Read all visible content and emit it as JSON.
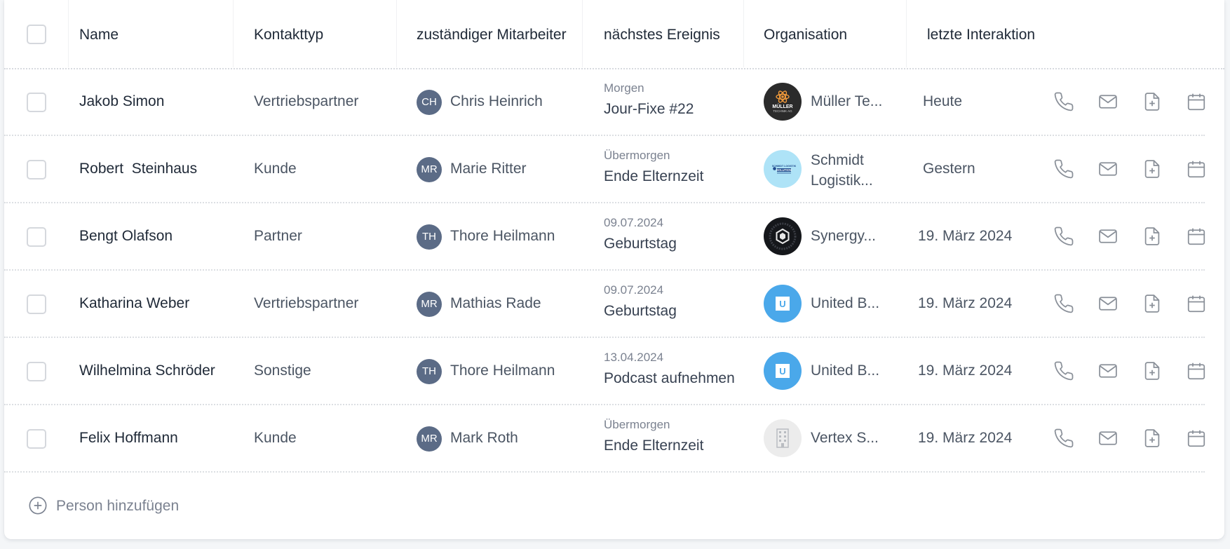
{
  "header": {
    "name": "Name",
    "contact_type": "Kontakttyp",
    "employee": "zuständiger Mitarbeiter",
    "next_event": "nächstes Ereignis",
    "organisation": "Organisation",
    "last_interaction": "letzte Interaktion"
  },
  "rows": [
    {
      "name": "Jakob Simon",
      "type": "Vertriebspartner",
      "initials": "CH",
      "employee": "Chris Heinrich",
      "event_date": "Morgen",
      "event_title": "Jour-Fixe #22",
      "org_line1": "Müller Te...",
      "org_line2": "",
      "org_logo": "mueller-logo",
      "last": "Heute"
    },
    {
      "name": "Robert  Steinhaus",
      "type": "Kunde",
      "initials": "MR",
      "employee": "Marie Ritter",
      "event_date": "Übermorgen",
      "event_title": "Ende Elternzeit",
      "org_line1": "Schmidt",
      "org_line2": "Logistik...",
      "org_logo": "schmidt-logo",
      "last": "Gestern"
    },
    {
      "name": "Bengt Olafson",
      "type": "Partner",
      "initials": "TH",
      "employee": "Thore Heilmann",
      "event_date": "09.07.2024",
      "event_title": "Geburtstag",
      "org_line1": "Synergy...",
      "org_line2": "",
      "org_logo": "synergy-logo",
      "last": "19. März 2024"
    },
    {
      "name": "Katharina Weber",
      "type": "Vertriebspartner",
      "initials": "MR",
      "employee": "Mathias Rade",
      "event_date": "09.07.2024",
      "event_title": "Geburtstag",
      "org_line1": "United B...",
      "org_line2": "",
      "org_logo": "united-logo",
      "last": "19. März 2024"
    },
    {
      "name": "Wilhelmina Schröder",
      "type": "Sonstige",
      "initials": "TH",
      "employee": "Thore Heilmann",
      "event_date": "13.04.2024",
      "event_title": "Podcast aufnehmen",
      "org_line1": "United B...",
      "org_line2": "",
      "org_logo": "united-logo",
      "last": "19. März 2024"
    },
    {
      "name": "Felix Hoffmann",
      "type": "Kunde",
      "initials": "MR",
      "employee": "Mark Roth",
      "event_date": "Übermorgen",
      "event_title": "Ende Elternzeit",
      "org_line1": "Vertex S...",
      "org_line2": "",
      "org_logo": "building-icon",
      "last": "19. März 2024"
    }
  ],
  "logo_text": {
    "mueller_line1": "MÜLLER",
    "mueller_line2": "TECHNIK AG",
    "schmidt_line1": "SCHMIDT LOGISTIK",
    "schmidt_line2": "SOLUTION",
    "united_letter": "U"
  },
  "add_label": "Person hinzufügen",
  "icons": [
    "phone-icon",
    "mail-icon",
    "file-plus-icon",
    "calendar-icon"
  ],
  "colors": {
    "avatar_bg": "#5b6b86",
    "icon_stroke": "#8a9099",
    "united_blue": "#4aa8ea",
    "schmidt_bg": "#aee3f7"
  }
}
